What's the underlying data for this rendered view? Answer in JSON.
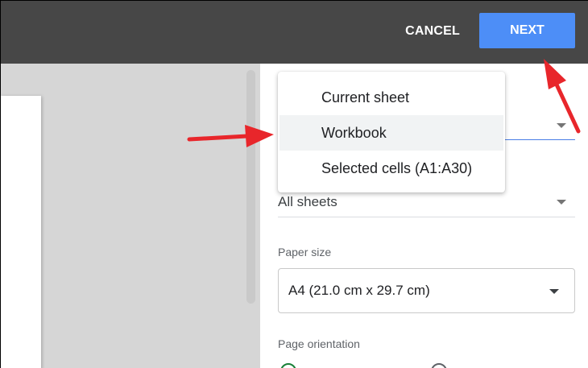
{
  "header": {
    "cancel_label": "CANCEL",
    "next_label": "NEXT"
  },
  "export_menu": {
    "items": [
      {
        "label": "Current sheet"
      },
      {
        "label": "Workbook"
      },
      {
        "label": "Selected cells (A1:A30)"
      }
    ],
    "highlighted": "Workbook"
  },
  "settings": {
    "pages_value": "All sheets",
    "paper_size_label": "Paper size",
    "paper_size_value": "A4 (21.0 cm x 29.7 cm)",
    "orientation_label": "Page orientation"
  },
  "colors": {
    "topbar": "#474747",
    "next_button": "#4d8ef7",
    "annotation_arrow": "#e8262b",
    "radio_selected": "#188038"
  }
}
